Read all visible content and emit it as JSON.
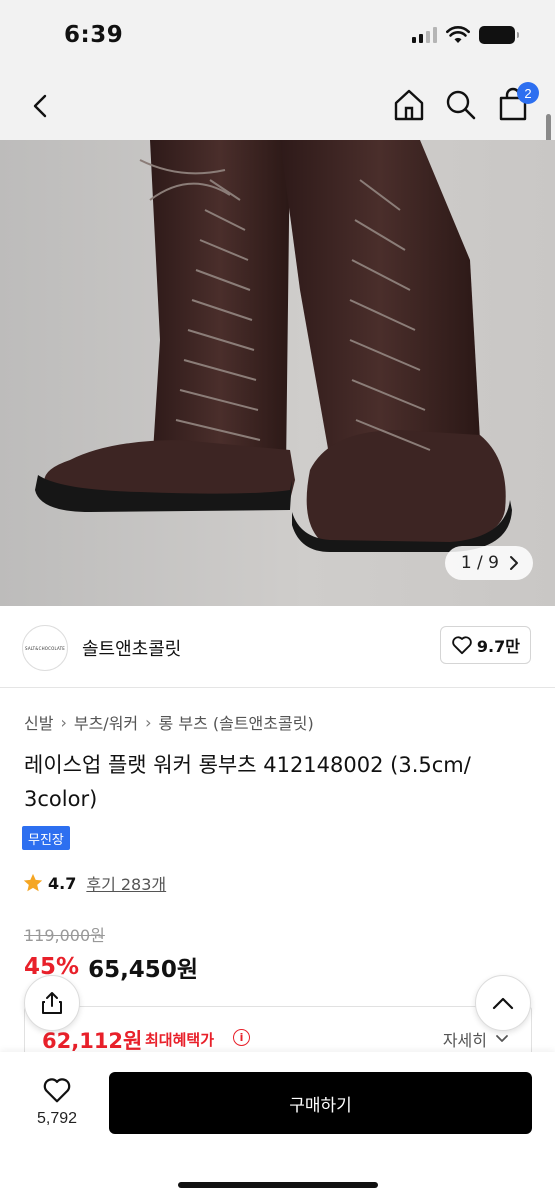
{
  "status_bar": {
    "time": "6:39"
  },
  "nav": {
    "cart_count": "2"
  },
  "gallery": {
    "counter": "1 / 9",
    "current": 1,
    "total": 9
  },
  "brand": {
    "logo_text": "SALT&CHOCOLATE",
    "name": "솔트앤초콜릿",
    "likes": "9.7만"
  },
  "breadcrumb": [
    "신발",
    "부츠/워커",
    "롱 부츠 (솔트앤초콜릿)"
  ],
  "product": {
    "title": "레이스업 플랫 워커 롱부츠 412148002 (3.5cm/ 3color)",
    "tag": "무진장",
    "rating": "4.7",
    "reviews": "후기 283개",
    "original_price": "119,000원",
    "discount": "45%",
    "price": "65,450원"
  },
  "benefit": {
    "price": "62,112원",
    "label": "최대혜택가",
    "detail": "자세히"
  },
  "bottom": {
    "wish_count": "5,792",
    "buy_label": "구매하기"
  },
  "colors": {
    "accent_blue": "#2d6ff0",
    "sale_red": "#e8202a",
    "star": "#f5a623",
    "boot_brown": "#3f2624"
  }
}
